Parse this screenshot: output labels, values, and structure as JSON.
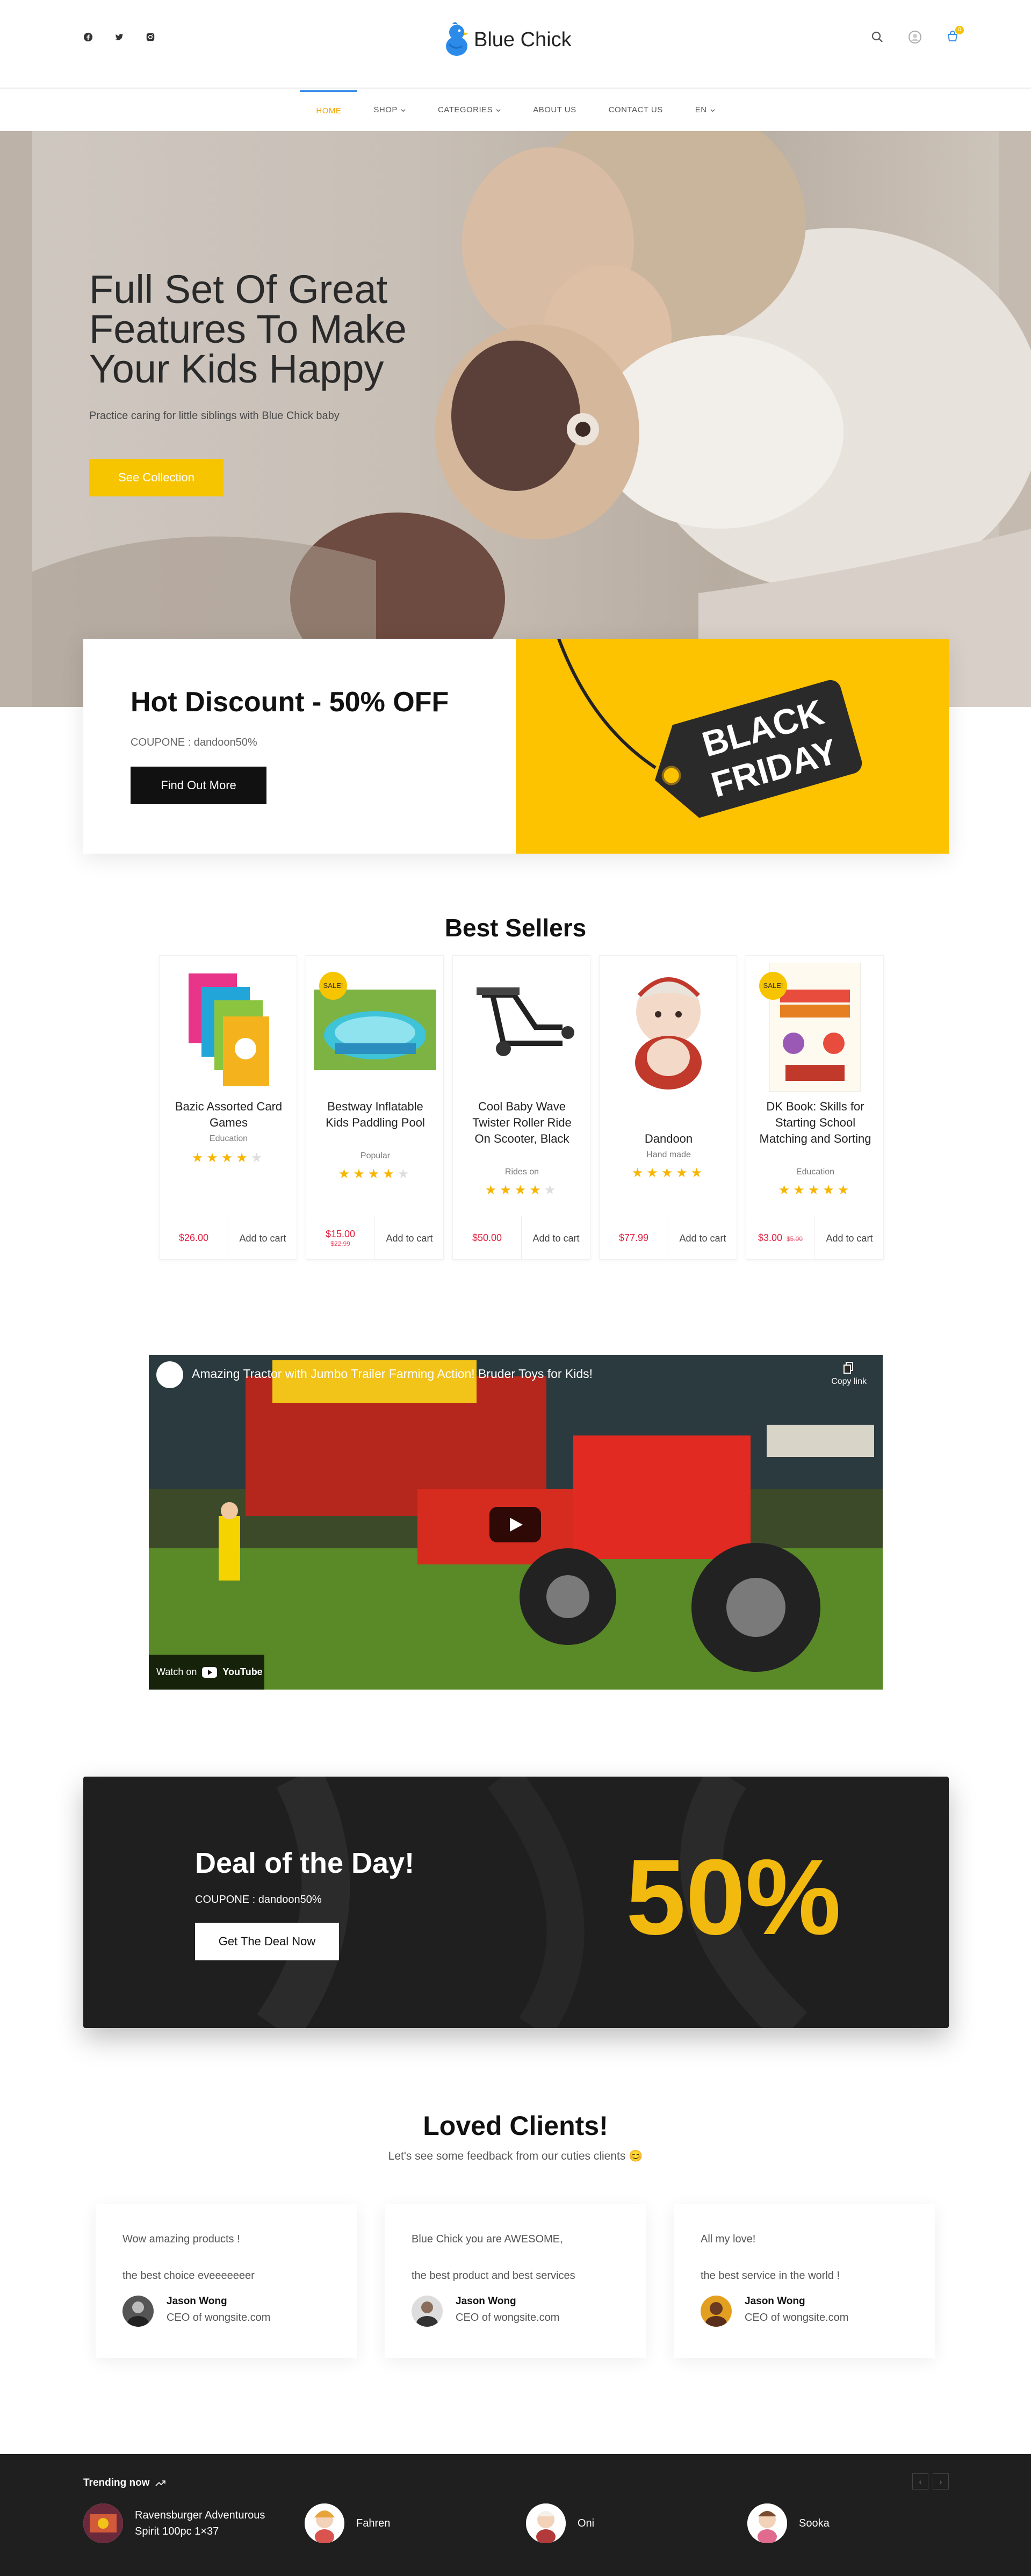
{
  "header": {
    "logo_text": "Blue Chick",
    "cart_count": "0",
    "social_icons": [
      "facebook-icon",
      "twitter-icon",
      "instagram-icon"
    ],
    "tool_icons": [
      "search-icon",
      "user-icon",
      "cart-icon"
    ]
  },
  "nav": {
    "items": [
      {
        "label": "HOME",
        "dropdown": false,
        "active": true
      },
      {
        "label": "SHOP",
        "dropdown": true
      },
      {
        "label": "CATEGORIES",
        "dropdown": true
      },
      {
        "label": "ABOUT US",
        "dropdown": false
      },
      {
        "label": "CONTACT US",
        "dropdown": false
      },
      {
        "label": "EN",
        "dropdown": true
      }
    ]
  },
  "hero": {
    "title": "Full Set Of Great Features To Make Your Kids Happy",
    "subtitle": "Practice caring for little siblings with Blue Chick baby",
    "button": "See Collection"
  },
  "discount": {
    "title": "Hot Discount - 50% OFF",
    "coupon": "COUPONE : dandoon50%",
    "button": "Find Out More",
    "tag_line1": "BLACK",
    "tag_line2": "FRIDAY"
  },
  "best_sellers": {
    "title": "Best Sellers",
    "sale_label": "SALE!",
    "add_to_cart": "Add to cart",
    "products": [
      {
        "name": "Bazic Assorted Card Games",
        "category": "Education",
        "rating": 4,
        "price": "$26.00",
        "old_price": "",
        "sale": false
      },
      {
        "name": "Bestway Inflatable Kids Paddling Pool",
        "category": "Popular",
        "rating": 4,
        "price": "$15.00",
        "old_price": "$22.99",
        "sale": true
      },
      {
        "name": "Cool Baby Wave Twister Roller Ride On Scooter, Black",
        "category": "Rides on",
        "rating": 4,
        "price": "$50.00",
        "old_price": "",
        "sale": false
      },
      {
        "name": "Dandoon",
        "category": "Hand made",
        "rating": 5,
        "price": "$77.99",
        "old_price": "",
        "sale": false
      },
      {
        "name": "DK Book: Skills for Starting School Matching and Sorting",
        "category": "Education",
        "rating": 5,
        "price": "$3.00",
        "old_price": "$5.00",
        "sale": true
      }
    ]
  },
  "video": {
    "title": "Amazing Tractor with Jumbo Trailer Farming Action! Bruder Toys for Kids!",
    "copy_link": "Copy link",
    "watch_on": "Watch on",
    "youtube": "YouTube"
  },
  "deal": {
    "title": "Deal of the Day!",
    "coupon": "COUPONE : dandoon50%",
    "button": "Get The Deal Now",
    "percent": "50%"
  },
  "testimonials": {
    "title": "Loved Clients!",
    "subtitle": "Let's see some feedback from our cuties clients 😊",
    "items": [
      {
        "line1": "Wow amazing products !",
        "line2": "the best choice eveeeeeeer",
        "name": "Jason Wong",
        "role": "CEO of wongsite.com"
      },
      {
        "line1": "Blue Chick you are AWESOME,",
        "line2": "the best product and best services",
        "name": "Jason Wong",
        "role": "CEO of wongsite.com"
      },
      {
        "line1": "All my love!",
        "line2": "the best service in the world !",
        "name": "Jason Wong",
        "role": "CEO of wongsite.com"
      }
    ]
  },
  "trending": {
    "title": "Trending now",
    "prev": "‹",
    "next": "›",
    "items": [
      {
        "name": "Ravensburger Adventurous Spirit 100pc 1×37"
      },
      {
        "name": "Fahren"
      },
      {
        "name": "Oni"
      },
      {
        "name": "Sooka"
      }
    ]
  },
  "colors": {
    "accent": "#f7c400",
    "price": "#e21b3c",
    "dark": "#1f1f1f",
    "nav_active": "#3a8ee8"
  }
}
